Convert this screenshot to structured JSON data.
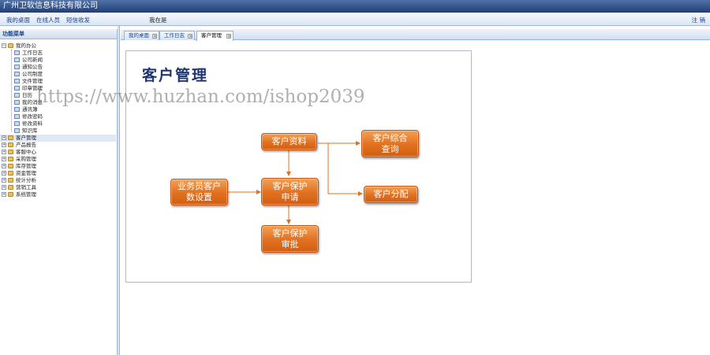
{
  "window": {
    "title": "广州卫软信息科技有限公司"
  },
  "topnav": {
    "links": [
      "我的桌面",
      "在线人员",
      "短信收发"
    ],
    "status": "我在是",
    "logout": "注 销"
  },
  "sidebar": {
    "header": "功能菜单",
    "tree": [
      {
        "label": "我的办公",
        "level": 0,
        "expanded": true
      },
      {
        "label": "工作日志",
        "level": 1
      },
      {
        "label": "公司新闻",
        "level": 1
      },
      {
        "label": "通知公告",
        "level": 1
      },
      {
        "label": "公司制度",
        "level": 1
      },
      {
        "label": "文件管理",
        "level": 1
      },
      {
        "label": "印章管理",
        "level": 1
      },
      {
        "label": "日历",
        "level": 1
      },
      {
        "label": "我的消息",
        "level": 1
      },
      {
        "label": "通讯簿",
        "level": 1
      },
      {
        "label": "修改密码",
        "level": 1
      },
      {
        "label": "修改资料",
        "level": 1
      },
      {
        "label": "知识库",
        "level": 1
      },
      {
        "label": "客户管理",
        "level": 0,
        "selected": true
      },
      {
        "label": "产品报告",
        "level": 0
      },
      {
        "label": "客服中心",
        "level": 0
      },
      {
        "label": "采购管理",
        "level": 0
      },
      {
        "label": "库存管理",
        "level": 0
      },
      {
        "label": "资金管理",
        "level": 0
      },
      {
        "label": "统计分析",
        "level": 0
      },
      {
        "label": "营销工具",
        "level": 0
      },
      {
        "label": "系统管理",
        "level": 0
      }
    ]
  },
  "tabs": [
    {
      "label": "我的桌面",
      "active": false
    },
    {
      "label": "工作日志",
      "active": false
    },
    {
      "label": "客户管理",
      "active": true
    }
  ],
  "main": {
    "title": "客户管理",
    "flow": {
      "customer_info": "客户资料",
      "customer_query": "客户综合查询",
      "customer_assign": "客户分配",
      "salesperson_setting": "业务员客户数设置",
      "protection_apply": "客户保护申请",
      "protection_approve": "客户保护审批"
    },
    "watermark": "https://www.huzhan.com/ishop2039"
  },
  "colors": {
    "box": "#e0701f",
    "connector": "#e0701f",
    "title": "#1f3570",
    "titlebar": "#2a4a82"
  }
}
